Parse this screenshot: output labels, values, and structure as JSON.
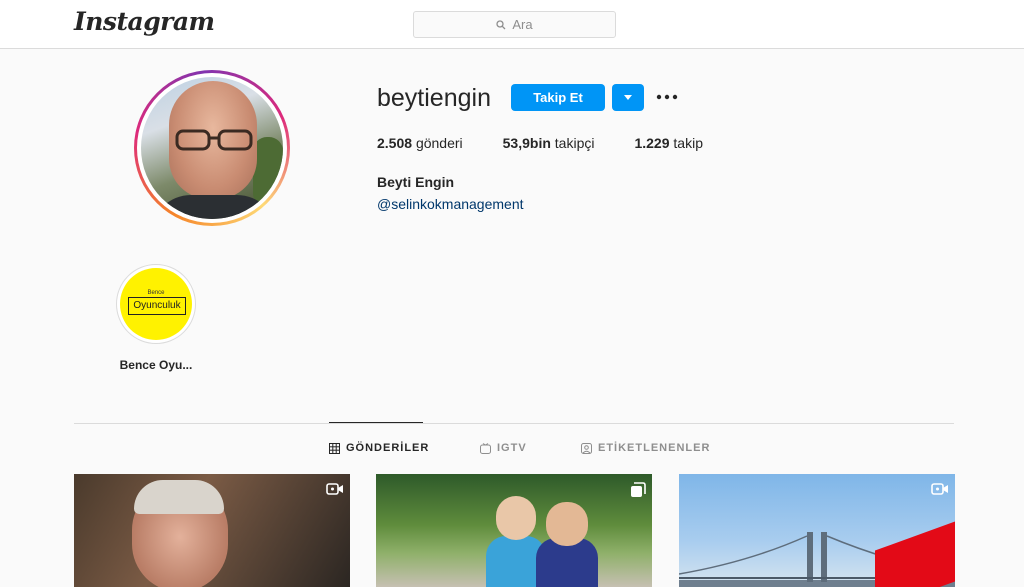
{
  "header": {
    "logo_text": "Instagram",
    "search_placeholder": "Ara"
  },
  "profile": {
    "username": "beytiengin",
    "follow_label": "Takip Et",
    "stats": [
      {
        "value": "2.508",
        "label": "gönderi"
      },
      {
        "value": "53,9bin",
        "label": "takipçi"
      },
      {
        "value": "1.229",
        "label": "takip"
      }
    ],
    "full_name": "Beyti Engin",
    "bio_link": "@selinkokmanagement"
  },
  "highlight": {
    "small_text": "Bence",
    "box_text": "Oyunculuk",
    "label": "Bence Oyu..."
  },
  "tabs": [
    {
      "label": "GÖNDERİLER",
      "icon": "grid-icon",
      "active": true
    },
    {
      "label": "IGTV",
      "icon": "igtv-icon",
      "active": false
    },
    {
      "label": "ETİKETLENENLER",
      "icon": "tagged-icon",
      "active": false
    }
  ],
  "posts": [
    {
      "type_icon": "video-icon"
    },
    {
      "type_icon": "carousel-icon"
    },
    {
      "type_icon": "video-icon"
    }
  ],
  "colors": {
    "accent": "#0095f6",
    "text": "#262626",
    "muted": "#8e8e8e",
    "link": "#00376b",
    "border": "#dbdbdb"
  }
}
